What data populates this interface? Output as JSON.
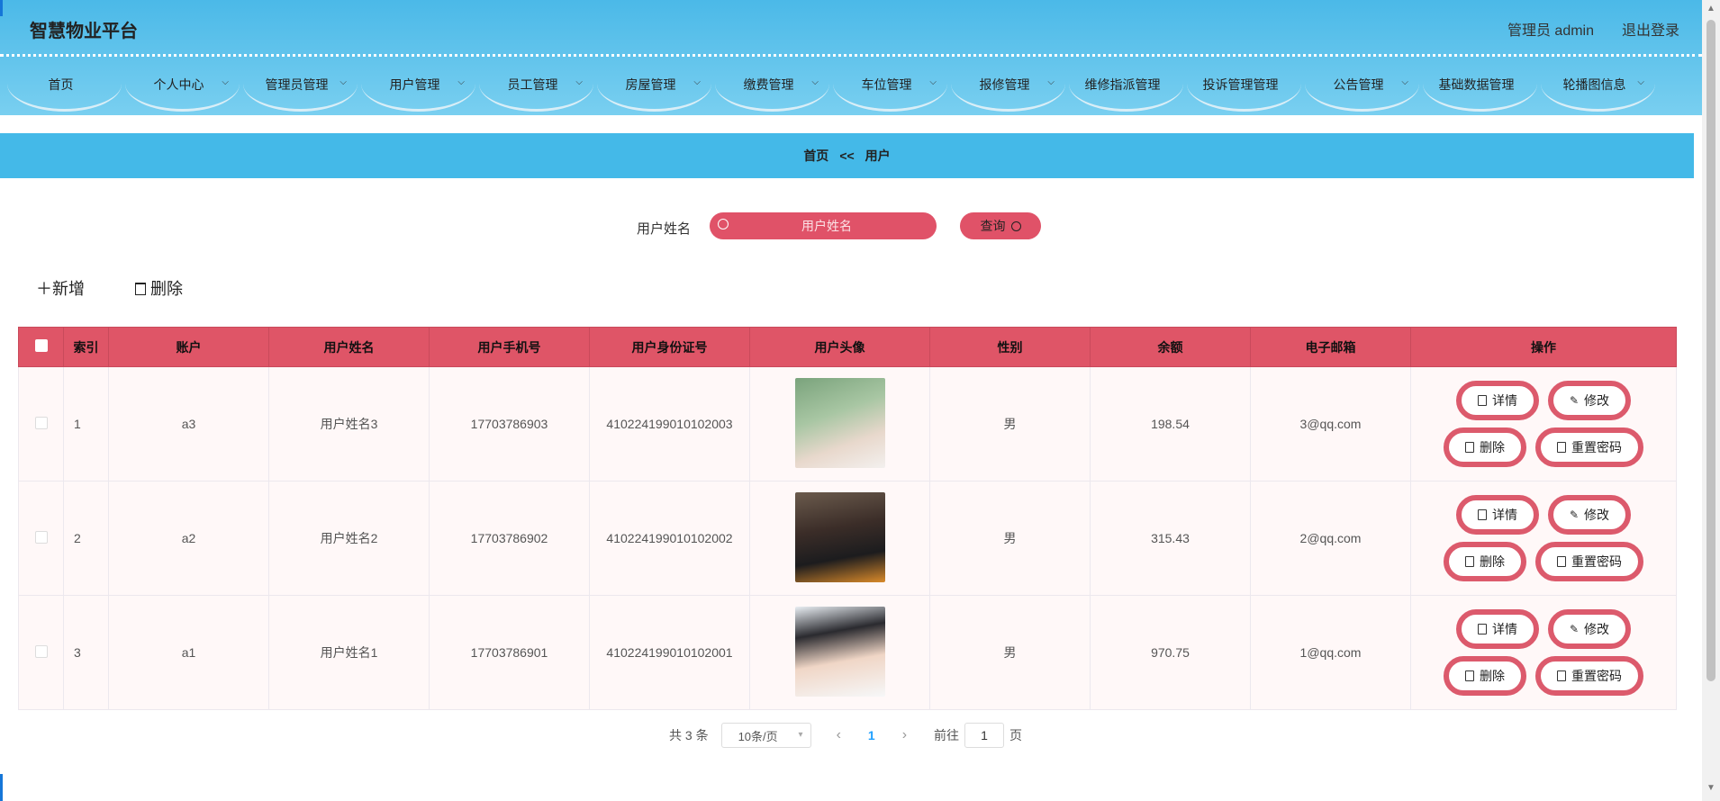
{
  "header": {
    "title": "智慧物业平台",
    "user_info": "管理员 admin",
    "logout": "退出登录"
  },
  "nav": [
    {
      "label": "首页",
      "dropdown": false
    },
    {
      "label": "个人中心",
      "dropdown": true
    },
    {
      "label": "管理员管理",
      "dropdown": true
    },
    {
      "label": "用户管理",
      "dropdown": true
    },
    {
      "label": "员工管理",
      "dropdown": true
    },
    {
      "label": "房屋管理",
      "dropdown": true
    },
    {
      "label": "缴费管理",
      "dropdown": true
    },
    {
      "label": "车位管理",
      "dropdown": true
    },
    {
      "label": "报修管理",
      "dropdown": true
    },
    {
      "label": "维修指派管理",
      "dropdown": false
    },
    {
      "label": "投诉管理管理",
      "dropdown": false
    },
    {
      "label": "公告管理",
      "dropdown": true
    },
    {
      "label": "基础数据管理",
      "dropdown": false
    },
    {
      "label": "轮播图信息",
      "dropdown": true
    }
  ],
  "breadcrumb": {
    "home": "首页",
    "sep": "<<",
    "current": "用户"
  },
  "search": {
    "label": "用户姓名",
    "placeholder": "用户姓名",
    "button": "查询"
  },
  "actions": {
    "add": "新增",
    "delete": "删除"
  },
  "table": {
    "headers": [
      "索引",
      "账户",
      "用户姓名",
      "用户手机号",
      "用户身份证号",
      "用户头像",
      "性别",
      "余额",
      "电子邮箱",
      "操作"
    ],
    "rows": [
      {
        "index": "1",
        "account": "a3",
        "name": "用户姓名3",
        "phone": "17703786903",
        "id_card": "410224199010102003",
        "gender": "男",
        "balance": "198.54",
        "email": "3@qq.com"
      },
      {
        "index": "2",
        "account": "a2",
        "name": "用户姓名2",
        "phone": "17703786902",
        "id_card": "410224199010102002",
        "gender": "男",
        "balance": "315.43",
        "email": "2@qq.com"
      },
      {
        "index": "3",
        "account": "a1",
        "name": "用户姓名1",
        "phone": "17703786901",
        "id_card": "410224199010102001",
        "gender": "男",
        "balance": "970.75",
        "email": "1@qq.com"
      }
    ],
    "ops": {
      "detail": "详情",
      "edit": "修改",
      "delete": "删除",
      "reset": "重置密码"
    }
  },
  "pagination": {
    "total": "共 3 条",
    "page_size": "10条/页",
    "current": "1",
    "goto": "前往",
    "jump_value": "1",
    "page_unit": "页"
  },
  "colors": {
    "accent": "#df5567",
    "header_blue": "#44b9e8"
  }
}
